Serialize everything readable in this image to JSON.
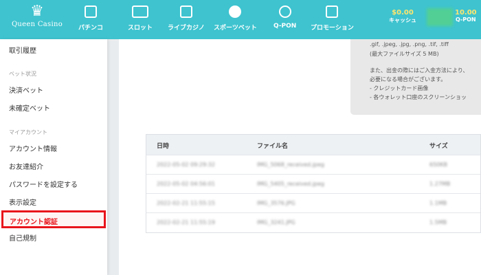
{
  "brand": {
    "line1": "Queen",
    "line2": "Casino",
    "crown_icon": "crown-icon"
  },
  "nav": [
    {
      "label": "パチンコ",
      "icon": "pachinko-icon"
    },
    {
      "label": "スロット",
      "icon": "slot-icon"
    },
    {
      "label": "ライブカジノ",
      "icon": "live-casino-icon"
    },
    {
      "label": "スポーツベット",
      "icon": "soccer-ball-icon"
    },
    {
      "label": "Q-PON",
      "icon": "qpon-icon"
    },
    {
      "label": "プロモーション",
      "icon": "gift-icon"
    }
  ],
  "balance": {
    "cash_amount": "$0.00",
    "cash_label": "キャッシュ",
    "qpon_amount": "10.00",
    "qpon_label": "Q-PON"
  },
  "sidebar": {
    "item_history": "取引履歴",
    "bet_header": "ベット状況",
    "item_settled": "決済ベット",
    "item_unsettled": "未確定ベット",
    "account_header": "マイアカウント",
    "item_account_info": "アカウント情報",
    "item_referral": "お友達紹介",
    "item_password": "パスワードを設定する",
    "item_display": "表示設定",
    "item_verification": "アカウント認証",
    "item_self_limit": "自己規制"
  },
  "notice": {
    "line1": ".gif, .jpeg, .jpg, .png, .tif, .tiff",
    "line2": "(最大ファイルサイズ 5 MB)",
    "line3": "また、出金の際にはご入金方法により、",
    "line4": "必要になる場合がございます。",
    "line5": "- クレジットカード画像",
    "line6": "- 各ウォレット口座のスクリーンショッ"
  },
  "table": {
    "headers": {
      "date": "日時",
      "filename": "ファイル名",
      "size": "サイズ"
    },
    "rows": [
      {
        "date": "2022-05-02 09:29:32",
        "filename": "IMG_5068_received.jpeg",
        "size": "650KB"
      },
      {
        "date": "2022-05-02 04:56:01",
        "filename": "IMG_5405_received.jpeg",
        "size": "1.27MB"
      },
      {
        "date": "2022-02-21 11:55:15",
        "filename": "IMG_3576.JPG",
        "size": "1.1MB"
      },
      {
        "date": "2022-02-21 11:55:19",
        "filename": "IMG_3241.JPG",
        "size": "1.5MB"
      }
    ]
  }
}
